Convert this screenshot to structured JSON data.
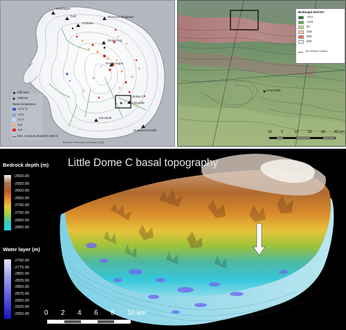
{
  "panel_a": {
    "places": [
      "Neumayer",
      "Troll",
      "Princess Elisabeth",
      "Kohnen",
      "Dome Fuji",
      "Dome Argus",
      "Dome C",
      "Concordia",
      "Zucchelli",
      "Dumont D'Urville"
    ],
    "legend": {
      "drill_sites": "Drill sites",
      "stations": "Stations",
      "heading": "Basal temperature",
      "items": [
        {
          "label": "-17.0 °C",
          "color": "#3b5bb5"
        },
        {
          "label": "-14.0",
          "color": "#7fa3d6"
        },
        {
          "label": "-11.0",
          "color": "#c7d7ee"
        },
        {
          "label": "-8.0",
          "color": "#f2b07a"
        },
        {
          "label": "-5.0",
          "color": "#d7301f"
        }
      ],
      "contours": "Elev. contours (Bamber), 500 m"
    },
    "credit": "Basal ice: Liefferinge and Pattyn (2013)"
  },
  "panel_b": {
    "legend_title": "Bedmap2-bed-DC",
    "legend_items": [
      {
        "label": "-374",
        "color": "#1a7a2e"
      },
      {
        "label": "-143",
        "color": "#6bb04a"
      },
      {
        "label": "87",
        "color": "#c8dc84"
      },
      {
        "label": "318",
        "color": "#f4d48a"
      },
      {
        "label": "550",
        "color": "#d8704a"
      },
      {
        "label": "620",
        "color": "#f7f2ee"
      }
    ],
    "surface_contour": "1m surface contour",
    "concordia": "Concordia",
    "scale_ticks": [
      "10",
      "0",
      "10",
      "20",
      "30",
      "40 km"
    ]
  },
  "panel_c": {
    "title": "Little Dome C basal topography",
    "bedrock_heading": "Bedrock depth (m)",
    "bedrock_ticks": [
      "-2500.00",
      "-2550.00",
      "-2600.00",
      "-2650.00",
      "-2700.00",
      "-2750.00",
      "-2800.00",
      "-2860.00"
    ],
    "water_heading": "Water layer (m)",
    "water_ticks": [
      "-2750.00",
      "-2775.00",
      "-2800.00",
      "-2825.00",
      "-2850.00",
      "-2875.00",
      "-2900.00",
      "-2925.00",
      "-2950.00"
    ],
    "scale_ticks": [
      "0",
      "2",
      "4",
      "6",
      "8",
      "10 km"
    ]
  }
}
